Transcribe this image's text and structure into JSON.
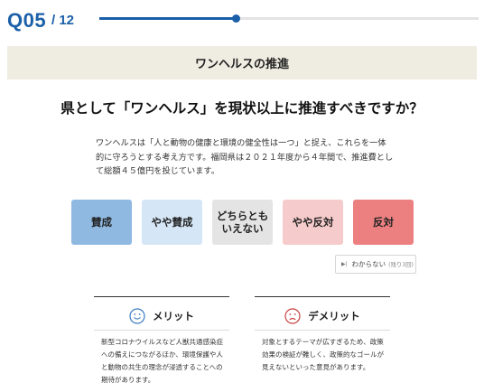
{
  "header": {
    "question_number": "Q05",
    "total": "/ 12",
    "progress": 0.36
  },
  "section": {
    "title": "ワンヘルスの推進"
  },
  "question": {
    "text": "県として「ワンヘルス」を現状以上に推進すべきですか？",
    "description": "ワンヘルスは「人と動物の健康と環境の健全性は一つ」と捉え、これらを一体的に守ろうとする考え方です。福岡県は２０２１年度から４年間で、推進費として総額４５億円を投じています。"
  },
  "choices": [
    {
      "label": "賛成",
      "color": "#8fb9e1"
    },
    {
      "label": "やや賛成",
      "color": "#d5e6f6"
    },
    {
      "label": "どちらともいえない",
      "color": "#e4e4e4"
    },
    {
      "label": "やや反対",
      "color": "#f6cbcb"
    },
    {
      "label": "反対",
      "color": "#ec8080"
    }
  ],
  "skip": {
    "label": "わからない",
    "remaining": "(残り3回)"
  },
  "merit": {
    "title": "メリット",
    "icon": "smile-icon",
    "text": "新型コロナウイルスなど人獣共通感染症への備えにつながるほか、環境保護や人と動物の共生の理念が浸透することへの期待があります。"
  },
  "demerit": {
    "title": "デメリット",
    "icon": "frown-icon",
    "text": "対象とするテーマが広すぎるため、政策効果の検証が難しく、政策的なゴールが見えないといった意見があります。"
  },
  "colors": {
    "accent": "#1a5fa8",
    "band": "#efede2"
  }
}
